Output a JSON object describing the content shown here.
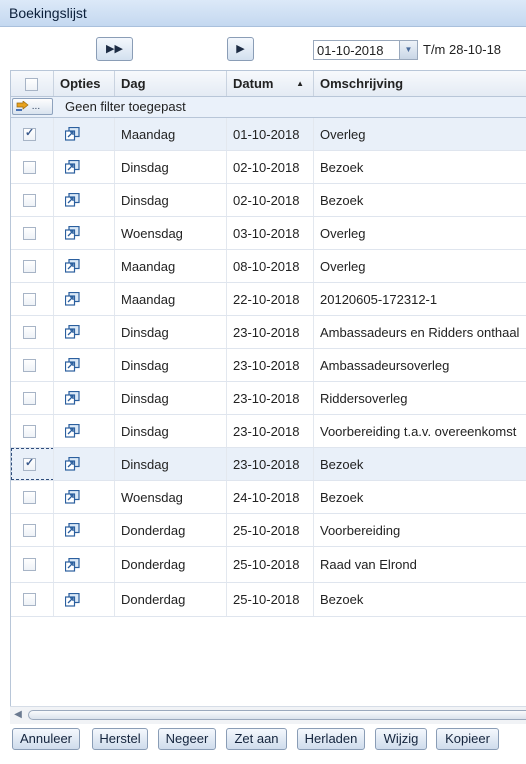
{
  "window": {
    "title": "Boekingslijst"
  },
  "toolbar": {
    "fast_forward_label": "▶▶",
    "play_label": "▶",
    "date_value": "01-10-2018",
    "range_end": "T/m 28-10-18"
  },
  "grid": {
    "columns": [
      "",
      "Opties",
      "Dag",
      "Datum",
      "Omschrijving"
    ],
    "sort_indicator": "▲",
    "filter_button": "...",
    "filter_text": "Geen filter toegepast",
    "rows": [
      {
        "checked": true,
        "dag": "Maandag",
        "datum": "01-10-2018",
        "omschrijving": "Overleg"
      },
      {
        "checked": false,
        "dag": "Dinsdag",
        "datum": "02-10-2018",
        "omschrijving": "Bezoek"
      },
      {
        "checked": false,
        "dag": "Dinsdag",
        "datum": "02-10-2018",
        "omschrijving": "Bezoek"
      },
      {
        "checked": false,
        "dag": "Woensdag",
        "datum": "03-10-2018",
        "omschrijving": "Overleg"
      },
      {
        "checked": false,
        "dag": "Maandag",
        "datum": "08-10-2018",
        "omschrijving": "Overleg"
      },
      {
        "checked": false,
        "dag": "Maandag",
        "datum": "22-10-2018",
        "omschrijving": "20120605-172312-1"
      },
      {
        "checked": false,
        "dag": "Dinsdag",
        "datum": "23-10-2018",
        "omschrijving": "Ambassadeurs en Ridders onthaal"
      },
      {
        "checked": false,
        "dag": "Dinsdag",
        "datum": "23-10-2018",
        "omschrijving": "Ambassadeursoverleg"
      },
      {
        "checked": false,
        "dag": "Dinsdag",
        "datum": "23-10-2018",
        "omschrijving": "Riddersoverleg"
      },
      {
        "checked": false,
        "dag": "Dinsdag",
        "datum": "23-10-2018",
        "omschrijving": "Voorbereiding t.a.v. overeenkomst"
      },
      {
        "checked": true,
        "dag": "Dinsdag",
        "datum": "23-10-2018",
        "omschrijving": "Bezoek"
      },
      {
        "checked": false,
        "dag": "Woensdag",
        "datum": "24-10-2018",
        "omschrijving": "Bezoek"
      },
      {
        "checked": false,
        "dag": "Donderdag",
        "datum": "25-10-2018",
        "omschrijving": "Voorbereiding"
      },
      {
        "checked": false,
        "dag": "Donderdag",
        "datum": "25-10-2018",
        "omschrijving": "Raad van Elrond"
      },
      {
        "checked": false,
        "dag": "Donderdag",
        "datum": "25-10-2018",
        "omschrijving": "Bezoek"
      }
    ]
  },
  "icons": {
    "options": "open-external-icon",
    "filter": "filter-icon"
  },
  "buttons": [
    "Annuleer",
    "Herstel",
    "Negeer",
    "Zet aan",
    "Herladen",
    "Wijzig",
    "Kopieer"
  ]
}
